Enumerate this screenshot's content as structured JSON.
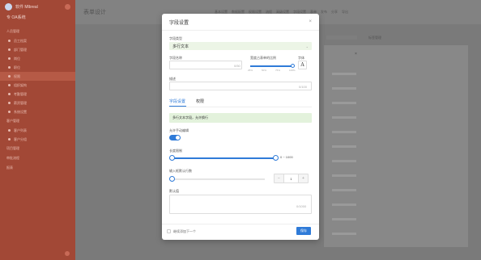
{
  "sidebar": {
    "brand": "软件 Mlbreal",
    "org": "专 OA系统",
    "group1": "人员管理",
    "items1": [
      "员工档案",
      "部门管理",
      "岗位",
      "职位",
      "权限",
      "组织架构",
      "考勤管理",
      "薪资管理",
      "系统设置"
    ],
    "group2": "客户管理",
    "items2": [
      "客户列表",
      "客户分组"
    ],
    "group3": "项目管理",
    "group4": "审批流程",
    "group5": "报表"
  },
  "topbar": {
    "title": "表单设计",
    "links": [
      "基本设置",
      "数据配置",
      "权限设置",
      "流程",
      "高级设置",
      "字段设置",
      "表单",
      "发布",
      "分享",
      "导出"
    ]
  },
  "background": {
    "right_label": "标签管理"
  },
  "modal": {
    "title": "字段设置",
    "close": "×",
    "field_type_label": "字段类型",
    "field_type_value": "多行文本",
    "field_name_label": "字段名称",
    "field_name_counter": "0/50",
    "proportion_label": "宽度占表单的比例",
    "proportion_ticks": [
      "25%",
      "50%",
      "75%",
      "100%"
    ],
    "font_label": "字体",
    "font_icon": "A",
    "desc_label": "描述",
    "desc_counter": "0/100",
    "tabs": [
      "字段设置",
      "权限"
    ],
    "info_text": "多行文本字段，允许换行",
    "required_label": "允许手动编辑",
    "length_label": "长度限制",
    "length_range_text": "0 ~ 1000",
    "rows_label": "输入框默认行数",
    "rows_value": "1",
    "step_minus": "−",
    "step_plus": "+",
    "default_label": "默认值",
    "default_counter": "0/1000",
    "next_label": "继续添加下一个",
    "save": "保存"
  },
  "colors": {
    "accent": "#2f7bd8",
    "sidebar": "#a24836",
    "success_bg": "#e3f2dc"
  }
}
